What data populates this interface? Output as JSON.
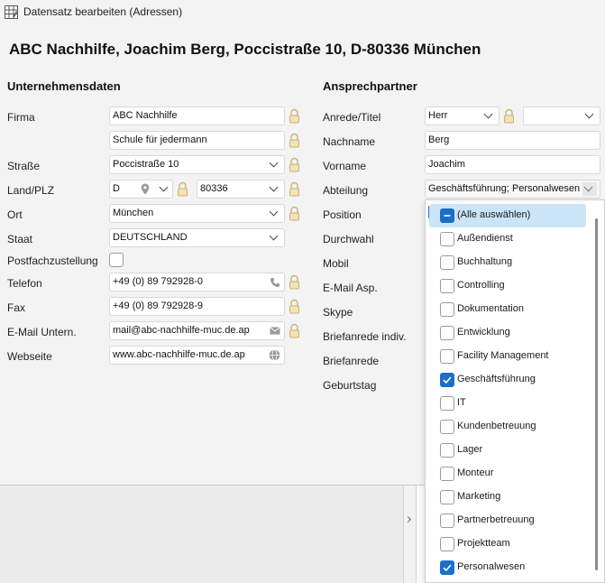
{
  "window": {
    "title": "Datensatz bearbeiten (Adressen)"
  },
  "header": {
    "title": "ABC Nachhilfe, Joachim Berg, Poccistraße 10, D-80336 München"
  },
  "company": {
    "section_title": "Unternehmensdaten",
    "firma_label": "Firma",
    "firma_value": "ABC Nachhilfe",
    "firma2_value": "Schule für jedermann",
    "strasse_label": "Straße",
    "strasse_value": "Poccistraße 10",
    "land_label": "Land/PLZ",
    "land_value": "D",
    "plz_value": "80336",
    "ort_label": "Ort",
    "ort_value": "München",
    "staat_label": "Staat",
    "staat_value": "DEUTSCHLAND",
    "postfach_label": "Postfachzustellung",
    "telefon_label": "Telefon",
    "telefon_value": "+49 (0) 89 792928-0",
    "fax_label": "Fax",
    "fax_value": "+49 (0) 89 792928-9",
    "email_label": "E-Mail Untern.",
    "email_value": "mail@abc-nachhilfe-muc.de.ap",
    "web_label": "Webseite",
    "web_value": "www.abc-nachhilfe-muc.de.ap"
  },
  "contact": {
    "section_title": "Ansprechpartner",
    "anrede_label": "Anrede/Titel",
    "anrede_value": "Herr",
    "titel_value": "",
    "nachname_label": "Nachname",
    "nachname_value": "Berg",
    "vorname_label": "Vorname",
    "vorname_value": "Joachim",
    "abteilung_label": "Abteilung",
    "abteilung_value": "Geschäftsführung; Personalwesen",
    "position_label": "Position",
    "durchwahl_label": "Durchwahl",
    "mobil_label": "Mobil",
    "email_asp_label": "E-Mail Asp.",
    "skype_label": "Skype",
    "briefanrede_indiv_label": "Briefanrede indiv.",
    "briefanrede_label": "Briefanrede",
    "geburtstag_label": "Geburtstag"
  },
  "dropdown": {
    "items": [
      {
        "label": "(Alle auswählen)",
        "state": "partial"
      },
      {
        "label": "Außendienst",
        "state": "unchecked"
      },
      {
        "label": "Buchhaltung",
        "state": "unchecked"
      },
      {
        "label": "Controlling",
        "state": "unchecked"
      },
      {
        "label": "Dokumentation",
        "state": "unchecked"
      },
      {
        "label": "Entwicklung",
        "state": "unchecked"
      },
      {
        "label": "Facility Management",
        "state": "unchecked"
      },
      {
        "label": "Geschäftsführung",
        "state": "checked"
      },
      {
        "label": "IT",
        "state": "unchecked"
      },
      {
        "label": "Kundenbetreuung",
        "state": "unchecked"
      },
      {
        "label": "Lager",
        "state": "unchecked"
      },
      {
        "label": "Monteur",
        "state": "unchecked"
      },
      {
        "label": "Marketing",
        "state": "unchecked"
      },
      {
        "label": "Partnerbetreuung",
        "state": "unchecked"
      },
      {
        "label": "Projektteam",
        "state": "unchecked"
      },
      {
        "label": "Personalwesen",
        "state": "checked"
      }
    ]
  },
  "colors": {
    "accent": "#1a6fc9",
    "selection": "#cce4f7",
    "window_bg": "#f3f3f3"
  }
}
